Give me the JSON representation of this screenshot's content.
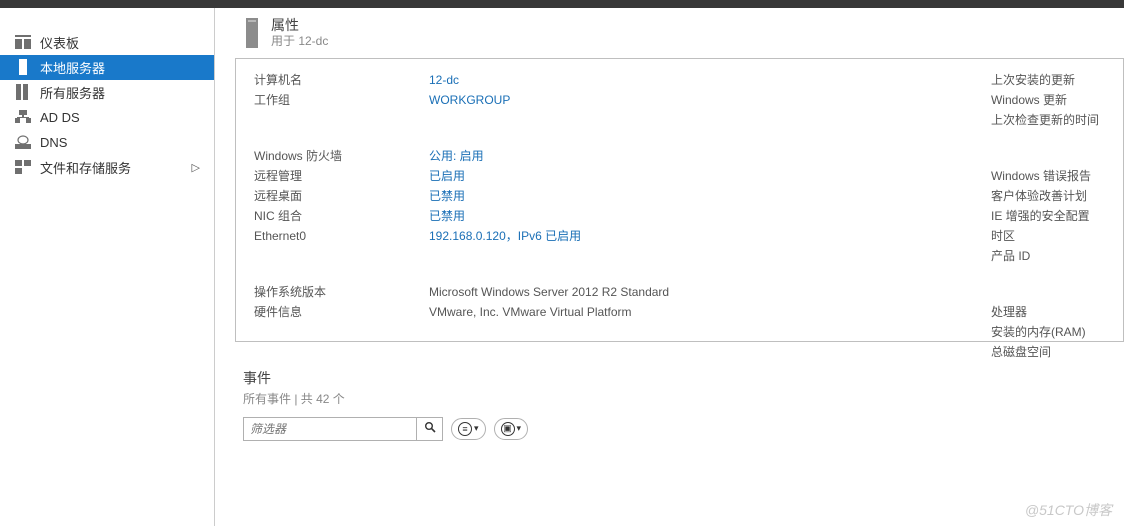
{
  "sidebar": {
    "items": [
      {
        "icon": "dashboard-icon",
        "label": "仪表板"
      },
      {
        "icon": "local-server-icon",
        "label": "本地服务器",
        "selected": true
      },
      {
        "icon": "all-servers-icon",
        "label": "所有服务器"
      },
      {
        "icon": "ad-ds-icon",
        "label": "AD DS"
      },
      {
        "icon": "dns-icon",
        "label": "DNS"
      },
      {
        "icon": "file-storage-icon",
        "label": "文件和存储服务",
        "has_submenu": true,
        "chevron": "▷"
      }
    ]
  },
  "properties": {
    "title": "属性",
    "subtitle": "用于 12-dc",
    "group1": {
      "computer_name_label": "计算机名",
      "computer_name_value": "12-dc",
      "workgroup_label": "工作组",
      "workgroup_value": "WORKGROUP"
    },
    "group2": {
      "firewall_label": "Windows 防火墙",
      "firewall_value": "公用: 启用",
      "remote_mgmt_label": "远程管理",
      "remote_mgmt_value": "已启用",
      "remote_desktop_label": "远程桌面",
      "remote_desktop_value": "已禁用",
      "nic_team_label": "NIC 组合",
      "nic_team_value": "已禁用",
      "ethernet_label": "Ethernet0",
      "ethernet_value": "192.168.0.120，IPv6 已启用"
    },
    "group3": {
      "os_version_label": "操作系统版本",
      "os_version_value": "Microsoft Windows Server 2012 R2 Standard",
      "hardware_label": "硬件信息",
      "hardware_value": "VMware, Inc. VMware Virtual Platform"
    },
    "right": {
      "last_update_label": "上次安装的更新",
      "windows_update_label": "Windows 更新",
      "last_check_label": "上次检查更新的时间",
      "error_report_label": "Windows 错误报告",
      "ceip_label": "客户体验改善计划",
      "ie_esc_label": "IE 增强的安全配置",
      "timezone_label": "时区",
      "product_id_label": "产品 ID",
      "processor_label": "处理器",
      "ram_label": "安装的内存(RAM)",
      "disk_label": "总磁盘空间"
    }
  },
  "events": {
    "title": "事件",
    "subtitle": "所有事件 | 共 42 个",
    "filter_placeholder": "筛选器"
  },
  "watermark": "@51CTO博客"
}
